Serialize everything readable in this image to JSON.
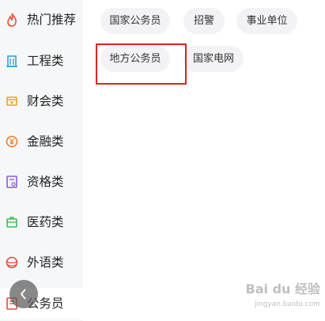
{
  "sidebar": {
    "items": [
      {
        "label": "热门推荐",
        "icon": "flame-icon",
        "color": "#ee4a33"
      },
      {
        "label": "工程类",
        "icon": "building-icon",
        "color": "#3a9fd6"
      },
      {
        "label": "财会类",
        "icon": "money-icon",
        "color": "#f3a21b"
      },
      {
        "label": "金融类",
        "icon": "yuan-coin-icon",
        "color": "#f07d2a"
      },
      {
        "label": "资格类",
        "icon": "certificate-icon",
        "color": "#8a5ad6"
      },
      {
        "label": "医药类",
        "icon": "medical-kit-icon",
        "color": "#3dbb5a"
      },
      {
        "label": "外语类",
        "icon": "globe-icon",
        "color": "#e8493b"
      },
      {
        "label": "公务员",
        "icon": "document-icon",
        "color": "#e8493b"
      }
    ]
  },
  "chips": [
    {
      "label": "国家公务员"
    },
    {
      "label": "招警"
    },
    {
      "label": "事业单位"
    },
    {
      "label": "地方公务员"
    },
    {
      "label": "国家电网"
    }
  ],
  "back_button": {
    "icon": "chevron-left-icon"
  },
  "watermark": {
    "text": "Bai du 经验",
    "url": "jingyan.baidu.com"
  }
}
